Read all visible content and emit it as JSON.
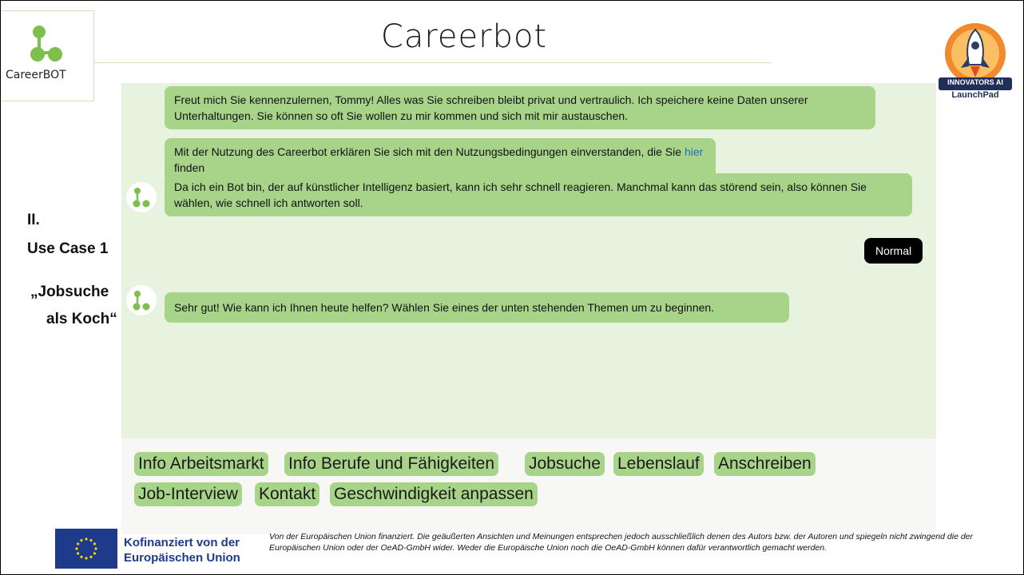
{
  "title": "Careerbot",
  "logo": {
    "text": "CareerBOT",
    "icon": "careerbot-molecule-icon",
    "color": "#7cc04b"
  },
  "badge": {
    "line1": "INNOVATORS AI",
    "line2": "LaunchPad",
    "icon": "rocket-icon"
  },
  "side_labels": {
    "section": "II.",
    "use_case": "Use Case 1",
    "quote_line1": "„Jobsuche",
    "quote_line2": "als Koch“"
  },
  "chat": {
    "messages": [
      {
        "text": "Freut mich Sie kennenzulernen, Tommy! Alles was Sie schreiben bleibt privat und vertraulich. Ich speichere keine Daten unserer Unterhaltungen. Sie können so oft Sie wollen zu mir kommen und sich mit mir austauschen."
      },
      {
        "text_before": "Mit der Nutzung des Careerbot erklären Sie sich mit den Nutzungsbedingungen einverstanden, die Sie ",
        "link": "hier",
        "text_after": " finden"
      },
      {
        "text": "Da ich ein Bot bin, der auf künstlicher Intelligenz basiert, kann ich sehr schnell reagieren. Manchmal kann das störend sein, also können Sie wählen, wie schnell ich antworten soll."
      },
      {
        "text": "Sehr gut! Wie kann ich Ihnen heute helfen? Wählen Sie eines der unten stehenden Themen um zu beginnen."
      }
    ],
    "user_reply": "Normal"
  },
  "topics": [
    "Info Arbeitsmarkt",
    "Info Berufe und Fähigkeiten",
    "Jobsuche",
    "Lebenslauf",
    "Anschreiben",
    "Job-Interview",
    "Kontakt",
    "Geschwindigkeit anpassen"
  ],
  "footer": {
    "eu_line1": "Kofinanziert von der",
    "eu_line2": "Europäischen Union",
    "disclaimer": "Von der Europäischen Union finanziert. Die geäußerten Ansichten und Meinungen entsprechen jedoch ausschließlich denen des Autors bzw. der Autoren und spiegeln nicht zwingend die der Europäischen Union oder der OeAD-GmbH wider. Weder die Europäische Union noch die OeAD-GmbH können dafür verantwortlich gemacht werden."
  },
  "colors": {
    "bubble": "#a8d48a",
    "chat_bg": "#e8f3df",
    "user_bubble": "#000000",
    "eu_blue": "#1e3a8a"
  }
}
